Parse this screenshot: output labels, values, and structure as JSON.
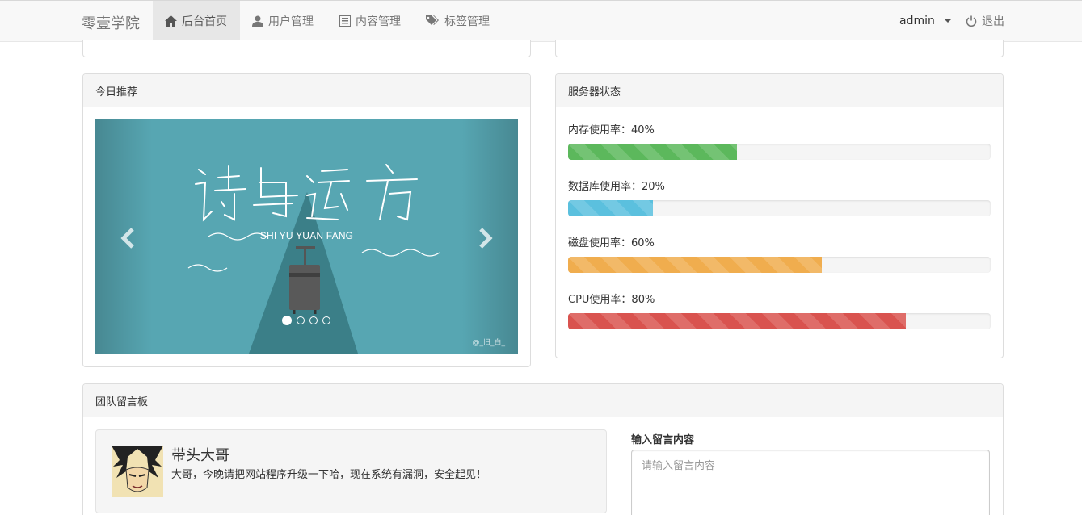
{
  "navbar": {
    "brand": "零壹学院",
    "items": [
      {
        "label": "后台首页",
        "icon": "home-icon",
        "active": true
      },
      {
        "label": "用户管理",
        "icon": "user-icon",
        "active": false
      },
      {
        "label": "内容管理",
        "icon": "list-alt-icon",
        "active": false
      },
      {
        "label": "标签管理",
        "icon": "tags-icon",
        "active": false
      }
    ],
    "user": "admin",
    "logout": "退出"
  },
  "recommend": {
    "title": "今日推荐",
    "slide_subtitle": "SHI YU YUAN FANG",
    "slide_title": "诗与远方",
    "watermark": "@_旧_白_",
    "slide_count": 4,
    "active_slide": 1
  },
  "server": {
    "title": "服务器状态",
    "metrics": [
      {
        "label": "内存使用率：40%",
        "percent": 40,
        "color": "#5cb85c"
      },
      {
        "label": "数据库使用率：20%",
        "percent": 20,
        "color": "#5bc0de"
      },
      {
        "label": "磁盘使用率：60%",
        "percent": 60,
        "color": "#f0ad4e"
      },
      {
        "label": "CPU使用率：80%",
        "percent": 80,
        "color": "#d9534f"
      }
    ]
  },
  "board": {
    "title": "团队留言板",
    "message": {
      "name": "带头大哥",
      "text": "大哥，今晚请把网站程序升级一下哈，现在系统有漏洞，安全起见！"
    },
    "input_label": "输入留言内容",
    "input_placeholder": "请输入留言内容"
  }
}
